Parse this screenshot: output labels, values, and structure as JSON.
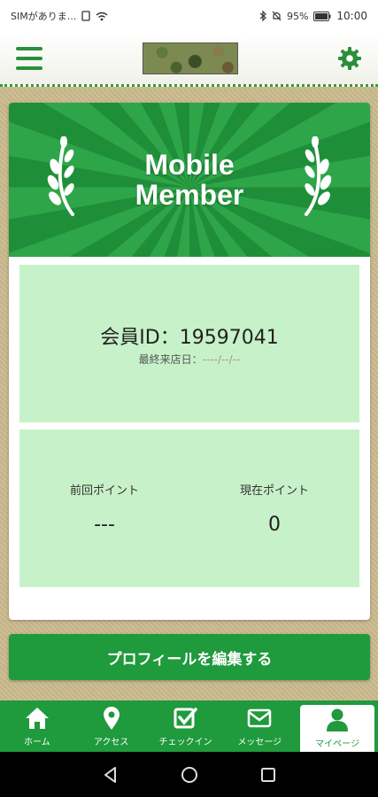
{
  "status_bar": {
    "carrier": "SIMがありま...",
    "battery": "95%",
    "time": "10:00"
  },
  "header": {
    "menu_icon": "hamburger-menu-icon",
    "settings_icon": "gear-icon"
  },
  "card": {
    "banner_line1": "Mobile",
    "banner_line2": "Member",
    "member_id_label": "会員ID：",
    "member_id": "19597041",
    "last_visit_label": "最終来店日：",
    "last_visit_value": "----/--/--"
  },
  "points": {
    "previous_label": "前回ポイント",
    "previous_value": "---",
    "current_label": "現在ポイント",
    "current_value": "0"
  },
  "edit_profile_label": "プロフィールを編集する",
  "tabs": [
    {
      "label": "ホーム",
      "icon": "home-icon"
    },
    {
      "label": "アクセス",
      "icon": "map-pin-icon"
    },
    {
      "label": "チェックイン",
      "icon": "checkin-icon"
    },
    {
      "label": "メッセージ",
      "icon": "mail-icon"
    },
    {
      "label": "マイページ",
      "icon": "user-icon"
    }
  ],
  "colors": {
    "primary_green": "#1f9a3c",
    "panel_green": "#c7f1c8"
  }
}
